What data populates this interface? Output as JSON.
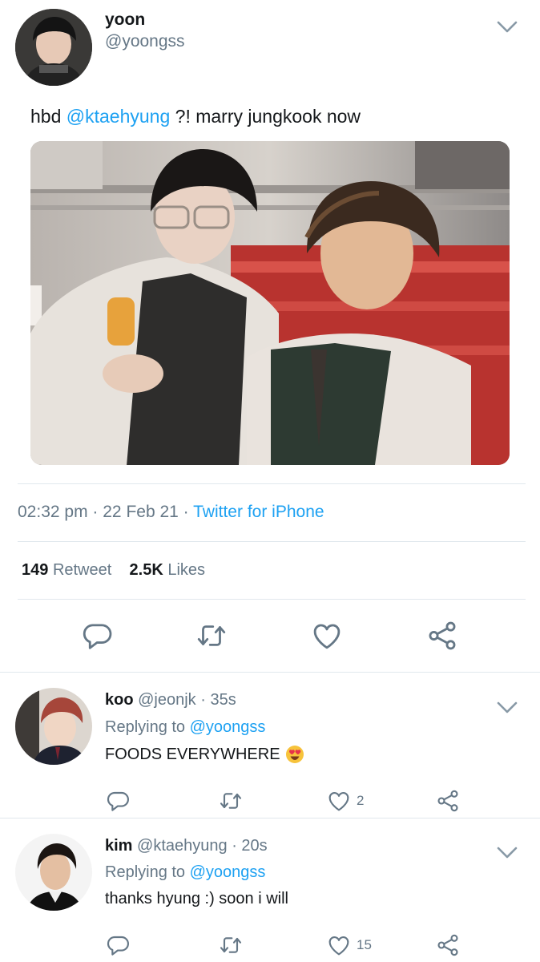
{
  "tweet": {
    "name": "yoon",
    "handle": "@yoongss",
    "text_prefix": "hbd ",
    "mention": "@ktaehyung",
    "text_suffix": " ?! marry jungkook now",
    "time": "02:32 pm",
    "date": "22 Feb 21",
    "source": "Twitter for iPhone",
    "separator": "·",
    "retweet_count": "149",
    "retweet_label": "Retweet",
    "likes_count": "2.5K",
    "likes_label": "Likes",
    "icons": [
      "reply-icon",
      "retweet-icon",
      "like-icon",
      "share-icon",
      "chevron-down-icon"
    ]
  },
  "replies": [
    {
      "name": "koo",
      "handle": "@jeonjk",
      "age": "· 35s",
      "replying_prefix": "Replying to",
      "replying_to": "@yoongss",
      "text": "FOODS EVERYWHERE",
      "emoji": "heart-eyes-emoji",
      "like_count": "2"
    },
    {
      "name": "kim",
      "handle": "@ktaehyung",
      "age": "· 20s",
      "replying_prefix": "Replying to",
      "replying_to": "@yoongss",
      "text": "thanks hyung :) soon i will",
      "like_count": "15"
    }
  ],
  "colors": {
    "accent": "#1da1f2",
    "secondary_text": "#657786",
    "primary_text": "#14171a",
    "divider": "#e1e8ed",
    "icon": "#657786"
  }
}
